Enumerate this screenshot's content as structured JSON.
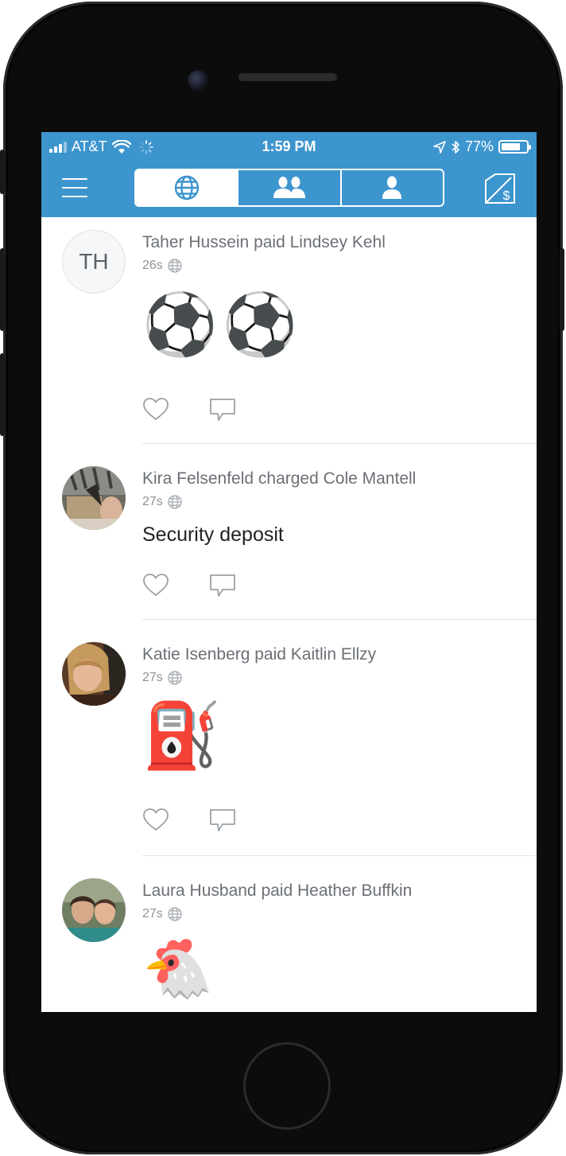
{
  "status_bar": {
    "carrier": "AT&T",
    "time": "1:59 PM",
    "battery": "77%",
    "battery_level": 0.77
  },
  "nav": {
    "tabs": [
      {
        "name": "global",
        "icon": "globe-icon",
        "active": true
      },
      {
        "name": "friends",
        "icon": "friends-icon",
        "active": false
      },
      {
        "name": "mine",
        "icon": "person-icon",
        "active": false
      }
    ],
    "menu_icon": "hamburger-menu-icon",
    "pay_icon": "pay-or-request-icon"
  },
  "feed": [
    {
      "initials": "TH",
      "title": "Taher Hussein paid Lindsey Kehl",
      "time": "26s",
      "note": "⚽⚽",
      "note_type": "emoji"
    },
    {
      "initials": "",
      "title": "Kira Felsenfeld charged Cole Mantell",
      "time": "27s",
      "note": "Security deposit",
      "note_type": "text"
    },
    {
      "initials": "",
      "title": "Katie Isenberg paid Kaitlin Ellzy",
      "time": "27s",
      "note": "⛽",
      "note_type": "emoji"
    },
    {
      "initials": "",
      "title": "Laura Husband paid Heather Buffkin",
      "time": "27s",
      "note": "🐔",
      "note_type": "emoji"
    }
  ],
  "colors": {
    "brand_blue": "#3d95ce",
    "title_gray": "#6b7076",
    "meta_gray": "#8d9298",
    "divider": "#e3e6e9"
  }
}
